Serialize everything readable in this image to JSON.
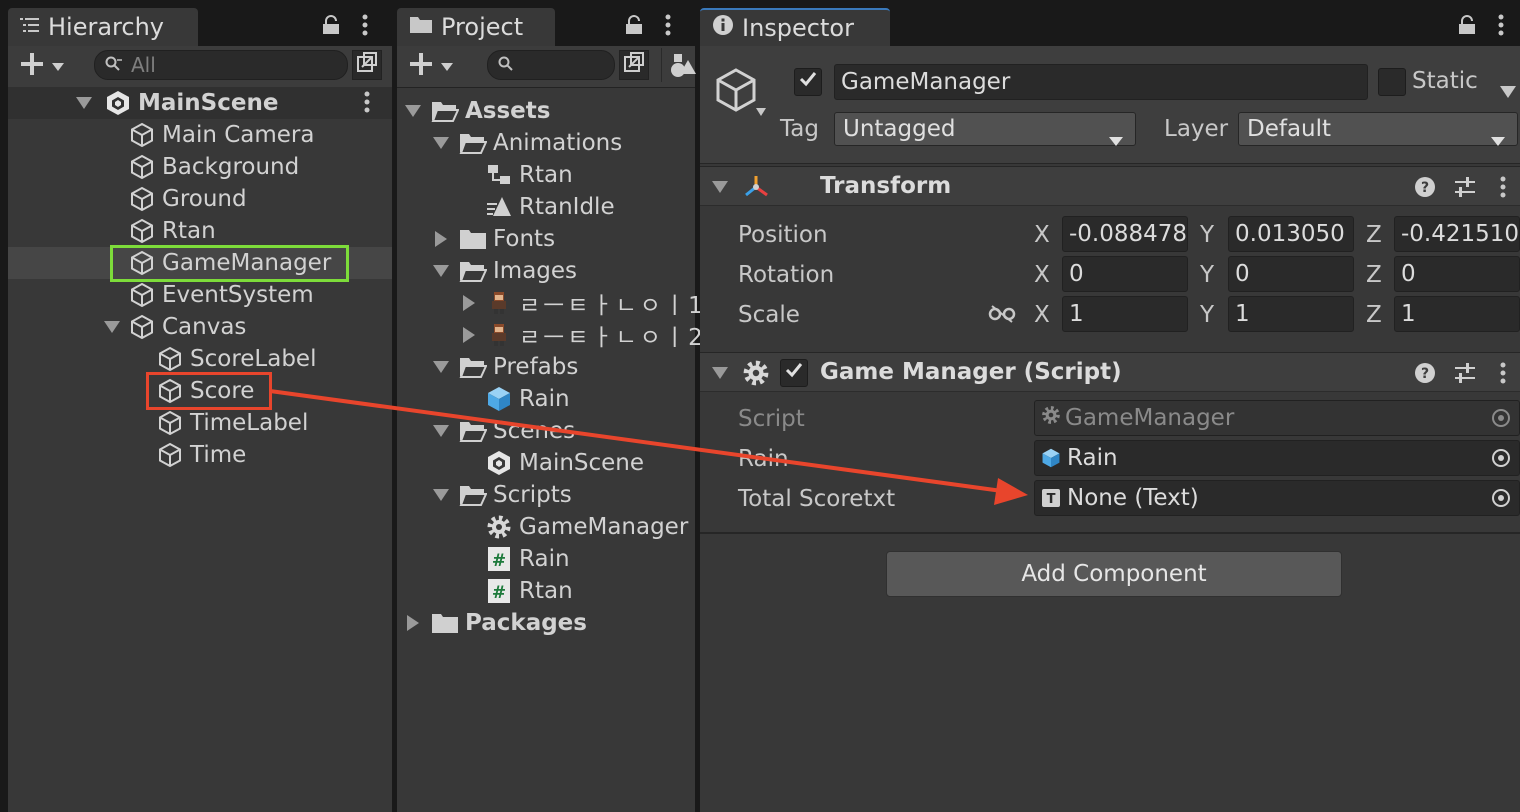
{
  "hierarchy": {
    "tab_title": "Hierarchy",
    "search_placeholder": "All",
    "scene_name": "MainScene",
    "items": [
      {
        "label": "Main Camera"
      },
      {
        "label": "Background"
      },
      {
        "label": "Ground"
      },
      {
        "label": "Rtan"
      },
      {
        "label": "GameManager"
      },
      {
        "label": "EventSystem"
      },
      {
        "label": "Canvas"
      },
      {
        "label": "ScoreLabel"
      },
      {
        "label": "Score"
      },
      {
        "label": "TimeLabel"
      },
      {
        "label": "Time"
      }
    ]
  },
  "project": {
    "tab_title": "Project",
    "tree": [
      {
        "label": "Assets"
      },
      {
        "label": "Animations"
      },
      {
        "label": "Rtan"
      },
      {
        "label": "RtanIdle"
      },
      {
        "label": "Fonts"
      },
      {
        "label": "Images"
      },
      {
        "label": "ㄹㅡㅌㅏㄴㅇㅣ1"
      },
      {
        "label": "ㄹㅡㅌㅏㄴㅇㅣ2"
      },
      {
        "label": "Prefabs"
      },
      {
        "label": "Rain"
      },
      {
        "label": "Scenes"
      },
      {
        "label": "MainScene"
      },
      {
        "label": "Scripts"
      },
      {
        "label": "GameManager"
      },
      {
        "label": "Rain"
      },
      {
        "label": "Rtan"
      },
      {
        "label": "Packages"
      }
    ]
  },
  "inspector": {
    "tab_title": "Inspector",
    "object_name": "GameManager",
    "static_label": "Static",
    "tag_label": "Tag",
    "tag_value": "Untagged",
    "layer_label": "Layer",
    "layer_value": "Default",
    "transform": {
      "title": "Transform",
      "position_label": "Position",
      "rotation_label": "Rotation",
      "scale_label": "Scale",
      "axis_x": "X",
      "axis_y": "Y",
      "axis_z": "Z",
      "position": {
        "x": "-0.088478",
        "y": "0.013050",
        "z": "-0.421510"
      },
      "rotation": {
        "x": "0",
        "y": "0",
        "z": "0"
      },
      "scale": {
        "x": "1",
        "y": "1",
        "z": "1"
      }
    },
    "game_manager": {
      "title": "Game Manager (Script)",
      "script_label": "Script",
      "script_value": "GameManager",
      "rain_label": "Rain",
      "rain_value": "Rain",
      "total_label": "Total Scoretxt",
      "total_value": "None (Text)"
    },
    "add_component": "Add Component"
  },
  "colors": {
    "highlight_green": "#7ddc3a",
    "highlight_red": "#e8452c",
    "arrow": "#e8452c"
  }
}
